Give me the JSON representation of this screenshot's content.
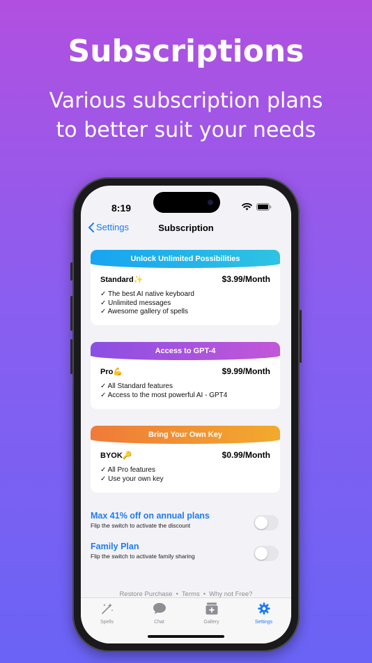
{
  "headline": "Subscriptions",
  "subline": [
    "Various subscription plans",
    "to better suit your needs"
  ],
  "status": {
    "time": "8:19"
  },
  "nav": {
    "back_label": "Settings",
    "title": "Subscription"
  },
  "plans": [
    {
      "banner": "Unlock Unlimited Possibilities",
      "banner_colors": [
        "#18a4f0",
        "#2ec3e3"
      ],
      "name": "Standard✨",
      "price": "$3.99",
      "period": "/Month",
      "features": [
        "✓ The best AI native keyboard",
        "✓ Unlimited messages",
        "✓ Awesome gallery of spells"
      ]
    },
    {
      "banner": "Access to GPT-4",
      "banner_colors": [
        "#8b4fe3",
        "#c257d8"
      ],
      "name": "Pro💪",
      "price": "$9.99",
      "period": "/Month",
      "features": [
        "✓ All Standard features",
        "✓ Access to the most powerful AI - GPT4"
      ]
    },
    {
      "banner": "Bring Your Own Key",
      "banner_colors": [
        "#f07a3a",
        "#f2aa2c"
      ],
      "name": "BYOK🔑",
      "price": "$0.99",
      "period": "/Month",
      "features": [
        "✓ All Pro features",
        "✓ Use your own key"
      ]
    }
  ],
  "toggles": [
    {
      "title": "Max 41% off on annual plans",
      "subtitle": "Flip the switch to activate the discount",
      "on": false
    },
    {
      "title": "Family Plan",
      "subtitle": "Flip the switch to activate family sharing",
      "on": false
    }
  ],
  "footer": {
    "restore": "Restore Purchase",
    "terms": "Terms",
    "why": "Why not Free?",
    "separator": "•"
  },
  "tabs": [
    {
      "label": "Spells",
      "icon": "sparkles-icon",
      "active": false
    },
    {
      "label": "Chat",
      "icon": "chat-bubble-icon",
      "active": false
    },
    {
      "label": "Gallery",
      "icon": "gallery-box-icon",
      "active": false
    },
    {
      "label": "Settings",
      "icon": "gear-icon",
      "active": true
    }
  ],
  "colors": {
    "accent": "#1e7cf2"
  }
}
